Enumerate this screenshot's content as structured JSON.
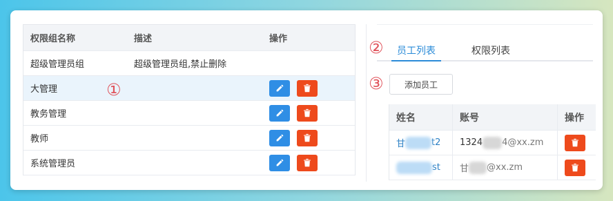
{
  "group_table": {
    "headers": [
      "权限组名称",
      "描述",
      "操作"
    ],
    "rows": [
      {
        "name": "超级管理员组",
        "desc": "超级管理员组,禁止删除",
        "actions": false
      },
      {
        "name": "大管理",
        "desc": "",
        "actions": true,
        "selected": true
      },
      {
        "name": "教务管理",
        "desc": "",
        "actions": true
      },
      {
        "name": "教师",
        "desc": "",
        "actions": true
      },
      {
        "name": "系统管理员",
        "desc": "",
        "actions": true
      }
    ]
  },
  "markers": [
    "①",
    "②",
    "③"
  ],
  "tabs": {
    "active": "员工列表",
    "inactive": "权限列表"
  },
  "add_employee_label": "添加员工",
  "emp_table": {
    "headers": [
      "姓名",
      "账号",
      "操作"
    ],
    "rows": [
      {
        "name_prefix": "甘",
        "name_suffix": "t2",
        "acct_prefix": "1324",
        "acct_suffix": "4@xx.zm"
      },
      {
        "name_prefix": "",
        "name_suffix": "st",
        "acct_prefix": "甘",
        "acct_suffix": "@xx.zm"
      }
    ]
  },
  "icons": {
    "edit": "pencil-icon",
    "delete": "trash-icon"
  },
  "colors": {
    "primary": "#2a8bd8",
    "danger": "#ee4a1c",
    "edit": "#2f8ee5",
    "marker": "#e0525a"
  }
}
